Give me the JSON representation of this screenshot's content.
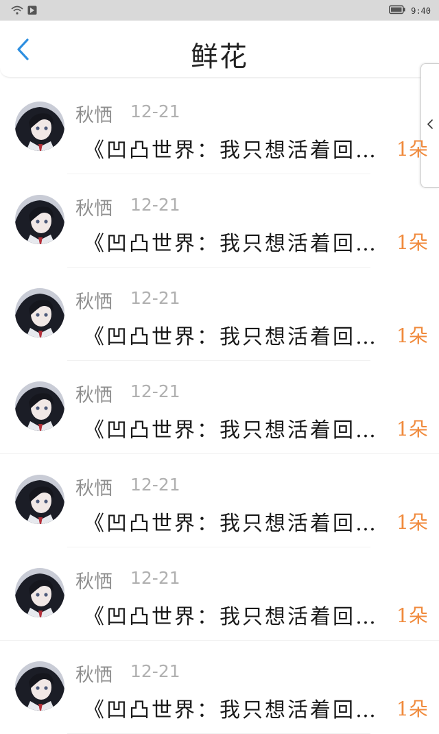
{
  "status_bar": {
    "time": "9:40",
    "icons": [
      "wifi-icon",
      "notification-icon",
      "battery-icon"
    ]
  },
  "header": {
    "title": "鲜花",
    "back_icon": "chevron-left-icon"
  },
  "side_tab": {
    "icon": "chevron-left-icon"
  },
  "list": {
    "items": [
      {
        "name": "秋恓",
        "date": "12-21",
        "book": "《凹凸世界：我只想活着回…",
        "count": "1朵"
      },
      {
        "name": "秋恓",
        "date": "12-21",
        "book": "《凹凸世界：我只想活着回…",
        "count": "1朵"
      },
      {
        "name": "秋恓",
        "date": "12-21",
        "book": "《凹凸世界：我只想活着回…",
        "count": "1朵"
      },
      {
        "name": "秋恓",
        "date": "12-21",
        "book": "《凹凸世界：我只想活着回…",
        "count": "1朵"
      },
      {
        "name": "秋恓",
        "date": "12-21",
        "book": "《凹凸世界：我只想活着回…",
        "count": "1朵"
      },
      {
        "name": "秋恓",
        "date": "12-21",
        "book": "《凹凸世界：我只想活着回…",
        "count": "1朵"
      },
      {
        "name": "秋恓",
        "date": "12-21",
        "book": "《凹凸世界：我只想活着回…",
        "count": "1朵"
      }
    ]
  },
  "colors": {
    "accent": "#2e8fe0",
    "count": "#f08a3c",
    "status_bar": "#d9d9d9"
  }
}
